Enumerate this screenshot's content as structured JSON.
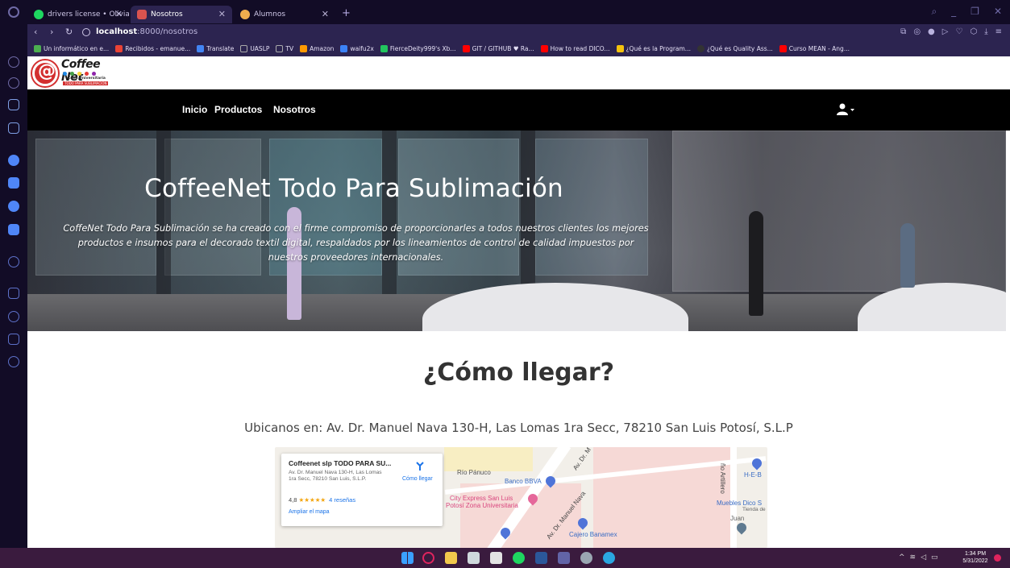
{
  "browser": {
    "tabs": [
      {
        "title": "drivers license • Olivia R",
        "icon_color": "#1ed760"
      },
      {
        "title": "Nosotros",
        "icon_color": "#d9534f"
      },
      {
        "title": "Alumnos",
        "icon_color": "#f0ad4e"
      }
    ],
    "url_host": "localhost",
    "url_path": ":8000/nosotros",
    "bookmarks": [
      {
        "label": "Un informático en e...",
        "color": "#4caf50"
      },
      {
        "label": "Recibidos - emanue...",
        "color": "#ea4335"
      },
      {
        "label": "Translate",
        "color": "#4285f4"
      },
      {
        "label": "UASLP",
        "color": "#777777"
      },
      {
        "label": "TV",
        "color": "#777777"
      },
      {
        "label": "Amazon",
        "color": "#ff9900"
      },
      {
        "label": "waifu2x",
        "color": "#3b82f6"
      },
      {
        "label": "FierceDeity999's Xb...",
        "color": "#22c55e"
      },
      {
        "label": "GIT / GITHUB ♥ Ra...",
        "color": "#ff0000"
      },
      {
        "label": "How to read DICO...",
        "color": "#ff0000"
      },
      {
        "label": "¿Qué es la Program...",
        "color": "#f4c20d"
      },
      {
        "label": "¿Qué es Quality Ass...",
        "color": "#333333"
      },
      {
        "label": "Curso MEAN - Ang...",
        "color": "#ff0000"
      }
    ]
  },
  "site": {
    "logo": {
      "title": "Coffee Net",
      "sub1": "Zona Universitaria",
      "sub2": "TODO PARA SUBLIMACIÓN"
    },
    "nav": [
      {
        "label": "Inicio"
      },
      {
        "label": "Productos"
      },
      {
        "label": "Nosotros"
      }
    ],
    "hero": {
      "title": "CoffeeNet Todo Para Sublimación",
      "text": "CoffeNet Todo Para Sublimación se ha creado con el firme compromiso de proporcionarles a todos nuestros clientes los mejores productos e insumos para el decorado textil digital, respaldados por los lineamientos de control de calidad impuestos por nuestros proveedores internacionales."
    },
    "como_llegar": "¿Cómo llegar?",
    "address": "Ubicanos en: Av. Dr. Manuel Nava 130-H, Las Lomas 1ra Secc, 78210 San Luis Potosí, S.L.P",
    "map": {
      "card_name": "Coffeenet slp TODO PARA SU...",
      "card_address": "Av. Dr. Manuel Nava 130-H, Las Lomas 1ra Secc, 78210 San Luis, S.L.P.",
      "rating": "4,8",
      "stars": "★★★★★",
      "reviews": "4 reseñas",
      "enlarge": "Ampliar el mapa",
      "directions": "Cómo llegar",
      "labels": {
        "rio_panuco": "Río Pánuco",
        "bbva": "Banco BBVA",
        "city_express_1": "City Express San Luis",
        "city_express_2": "Potosí Zona Universitaria",
        "av_nava_1": "Av. Dr. Manuel Nava",
        "av_nava_2": "Av. Dr. M",
        "banamex": "Cajero Banamex",
        "artillero": "ño Artillero",
        "heb": "H-E-B",
        "muebles": "Muebles Dico S",
        "tienda": "Tienda de",
        "juan": "Juan"
      }
    }
  },
  "taskbar": {
    "time": "1:34 PM",
    "date": "5/31/2022"
  }
}
